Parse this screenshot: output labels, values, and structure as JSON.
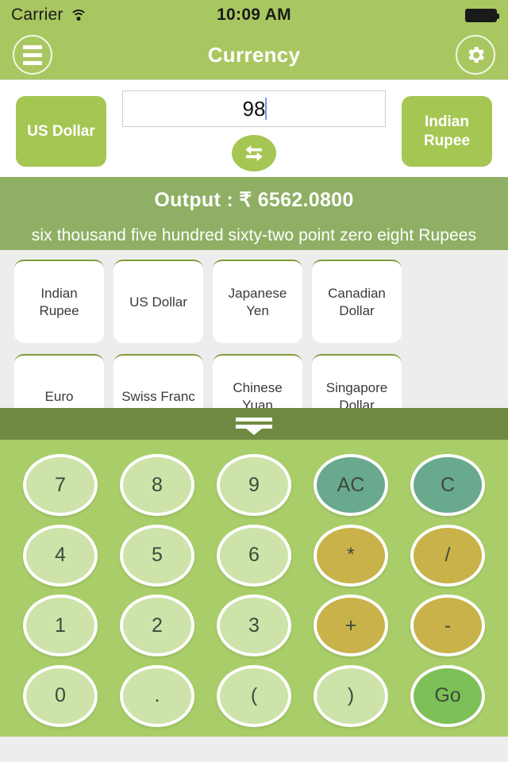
{
  "status_bar": {
    "carrier": "Carrier",
    "wifi_icon": "wifi-icon",
    "time": "10:09 AM",
    "battery_icon": "battery-full-icon"
  },
  "nav_bar": {
    "menu_icon": "hamburger-menu-icon",
    "title": "Currency",
    "settings_icon": "gear-icon"
  },
  "converter": {
    "from_currency": "US Dollar",
    "to_currency": "Indian Rupee",
    "amount_value": "98",
    "amount_placeholder": "",
    "swap_icon": "swap-arrows-icon"
  },
  "output": {
    "result_line": "Output : ₹ 6562.0800",
    "words_line": "six thousand five hundred sixty-two point zero eight Rupees"
  },
  "currency_cards": [
    "Indian Rupee",
    "US Dollar",
    "Japanese Yen",
    "Canadian Dollar",
    "Euro",
    "Swiss Franc",
    "Chinese Yuan",
    "Singapore Dollar"
  ],
  "drag_handle": {
    "icon": "drag-handle-icon"
  },
  "keypad": [
    {
      "label": "7",
      "type": "digit"
    },
    {
      "label": "8",
      "type": "digit"
    },
    {
      "label": "9",
      "type": "digit"
    },
    {
      "label": "AC",
      "type": "clear"
    },
    {
      "label": "C",
      "type": "clear"
    },
    {
      "label": "4",
      "type": "digit"
    },
    {
      "label": "5",
      "type": "digit"
    },
    {
      "label": "6",
      "type": "digit"
    },
    {
      "label": "*",
      "type": "op"
    },
    {
      "label": "/",
      "type": "op"
    },
    {
      "label": "1",
      "type": "digit"
    },
    {
      "label": "2",
      "type": "digit"
    },
    {
      "label": "3",
      "type": "digit"
    },
    {
      "label": "+",
      "type": "op"
    },
    {
      "label": "-",
      "type": "op"
    },
    {
      "label": "0",
      "type": "digit"
    },
    {
      "label": ".",
      "type": "digit"
    },
    {
      "label": "(",
      "type": "digit"
    },
    {
      "label": ")",
      "type": "digit"
    },
    {
      "label": "Go",
      "type": "go"
    }
  ],
  "colors": {
    "header_green": "#a9c760",
    "accent_green": "#a6c653",
    "output_green": "#8faf64",
    "handle_green": "#6f8a40",
    "keypad_bg": "#a9ce69",
    "key_digit": "#cde3a9",
    "key_clear": "#69a98d",
    "key_op": "#c9b24a",
    "key_go": "#7cc057"
  }
}
